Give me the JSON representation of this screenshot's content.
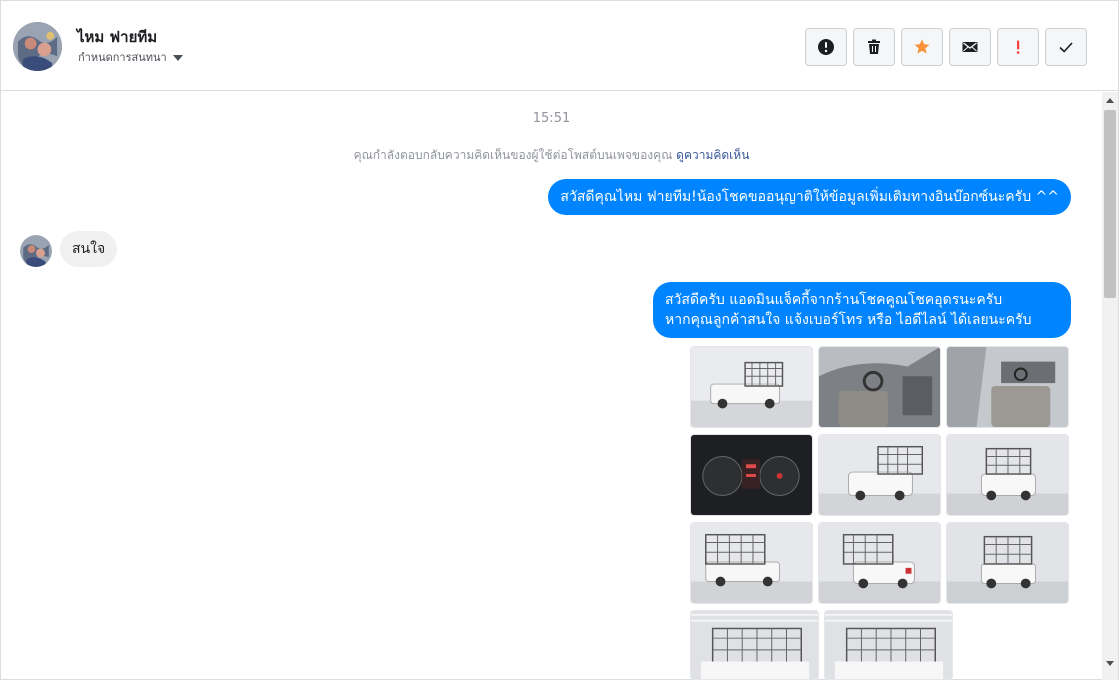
{
  "header": {
    "contact_name": "ไหม ฟายทีม",
    "settings_label": "กำหนดการสนทนา",
    "toolbar": [
      {
        "name": "report-button",
        "icon": "exclamation-circle-icon",
        "color": "#1c1e21"
      },
      {
        "name": "delete-button",
        "icon": "trash-icon",
        "color": "#1c1e21"
      },
      {
        "name": "star-button",
        "icon": "star-icon",
        "color": "#f7923b"
      },
      {
        "name": "mark-unread-button",
        "icon": "envelope-icon",
        "color": "#1c1e21"
      },
      {
        "name": "spam-button",
        "icon": "exclamation-icon",
        "color": "#fa3e3e"
      },
      {
        "name": "done-button",
        "icon": "check-icon",
        "color": "#1c1e21"
      }
    ]
  },
  "messages": {
    "timestamp": "15:51",
    "notice_text": "คุณกำลังตอบกลับความคิดเห็นของผู้ใช้ต่อโพสต์บนเพจของคุณ",
    "notice_link": "ดูความคิดเห็น",
    "msg1": "สวัสดีคุณไหม ฟายทีม!น้องโชคขออนุญาติให้ข้อมูลเพิ่มเติมทางอินบ๊อกซ์นะครับ ^^",
    "msg2": "สนใจ",
    "msg3_line1": "สวัสดีครับ แอดมินแจ็คกี้จากร้านโชคคูณโชคอุดรนะครับ",
    "msg3_line2": "หากคุณลูกค้าสนใจ แจ้งเบอร์โทร หรือ ไอดีไลน์ ได้เลยนะครับ"
  },
  "colors": {
    "outgoing_bubble": "#0084ff",
    "incoming_bubble": "#f1f0f0",
    "link": "#385898"
  }
}
